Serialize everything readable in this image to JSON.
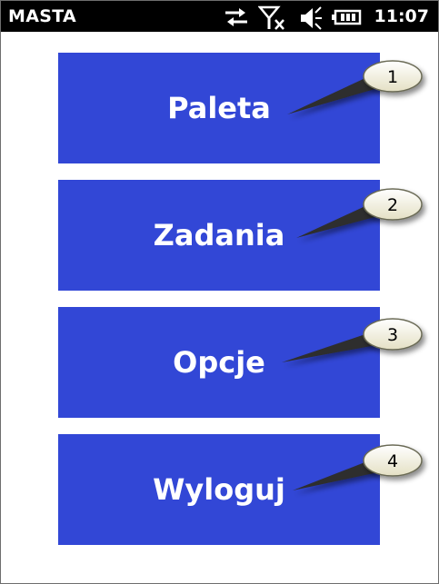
{
  "statusbar": {
    "app_title": "MASTA",
    "time": "11:07",
    "icons": [
      "sync-arrows-icon",
      "signal-off-icon",
      "speaker-muted-icon",
      "battery-icon"
    ]
  },
  "menu": {
    "buttons": [
      {
        "label": "Paleta"
      },
      {
        "label": "Zadania"
      },
      {
        "label": "Opcje"
      },
      {
        "label": "Wyloguj"
      }
    ]
  },
  "callouts": [
    "1",
    "2",
    "3",
    "4"
  ],
  "colors": {
    "button_bg": "#3247d6",
    "button_text": "#ffffff",
    "statusbar_bg": "#000000",
    "callout_fill": "#f2f0dc"
  }
}
